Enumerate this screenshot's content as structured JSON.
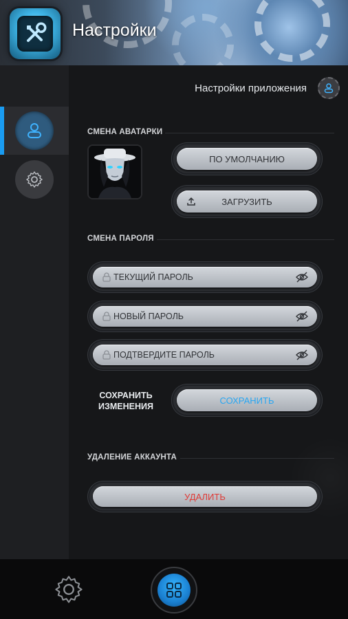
{
  "header": {
    "title": "Настройки",
    "app_icon": "tools-icon"
  },
  "sidebar": {
    "items": [
      {
        "name": "profile",
        "icon": "user-icon",
        "active": true
      },
      {
        "name": "settings",
        "icon": "gear-icon",
        "active": false
      }
    ],
    "accent": "#1a9cf2"
  },
  "main": {
    "heading": "Настройки приложения",
    "heading_icon": "user-icon",
    "avatar_section": {
      "title": "СМЕНА АВАТАРКИ",
      "default_button": "ПО УМОЛЧАНИЮ",
      "upload_button": "ЗАГРУЗИТЬ"
    },
    "password_section": {
      "title": "СМЕНА ПАРОЛЯ",
      "current_placeholder": "ТЕКУЩИЙ ПАРОЛЬ",
      "new_placeholder": "НОВЫЙ ПАРОЛЬ",
      "confirm_placeholder": "ПОДТВЕРДИТЕ ПАРОЛЬ",
      "save_label": "СОХРАНИТЬ ИЗМЕНЕНИЯ",
      "save_button": "СОХРАНИТЬ"
    },
    "delete_section": {
      "title": "УДАЛЕНИЕ АККАУНТА",
      "delete_button": "УДАЛИТЬ"
    }
  },
  "bottom_nav": {
    "left_icon": "gear-icon",
    "center_icon": "grid-icon"
  },
  "colors": {
    "save_text": "#27a6f2",
    "delete_text": "#e03a36",
    "header_accent": "#6f8fb3"
  }
}
